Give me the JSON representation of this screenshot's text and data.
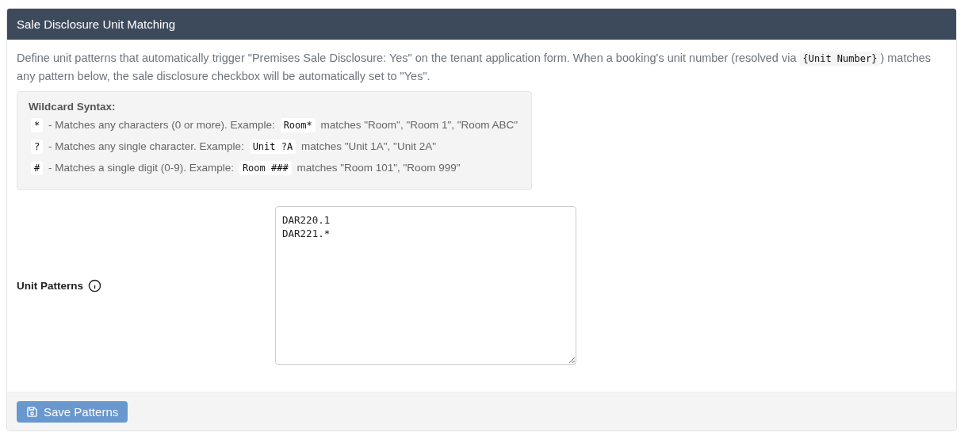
{
  "card": {
    "title": "Sale Disclosure Unit Matching"
  },
  "description": [
    {
      "kind": "text",
      "text": "Define unit patterns that automatically trigger \"Premises Sale Disclosure: Yes\" on the tenant application form. When a booking's unit number (resolved via "
    },
    {
      "kind": "code",
      "text": "{Unit Number}"
    },
    {
      "kind": "text",
      "text": ") matches any pattern below, the sale disclosure checkbox will be automatically set to \"Yes\"."
    }
  ],
  "syntax": {
    "title": "Wildcard Syntax:",
    "rules": [
      {
        "symbol": "*",
        "text": "- Matches any characters (0 or more). Example:",
        "example": "Room*",
        "matches": "matches \"Room\", \"Room 1\", \"Room ABC\""
      },
      {
        "symbol": "?",
        "text": "- Matches any single character. Example:",
        "example": "Unit ?A",
        "matches": "matches \"Unit 1A\", \"Unit 2A\""
      },
      {
        "symbol": "#",
        "text": "- Matches a single digit (0-9). Example:",
        "example": "Room ###",
        "matches": "matches \"Room 101\", \"Room 999\""
      }
    ]
  },
  "field": {
    "label": "Unit Patterns",
    "lines": [
      "DAR220.1",
      "DAR221.*"
    ]
  },
  "save_button": {
    "label": "Save Patterns",
    "disabled": true
  }
}
